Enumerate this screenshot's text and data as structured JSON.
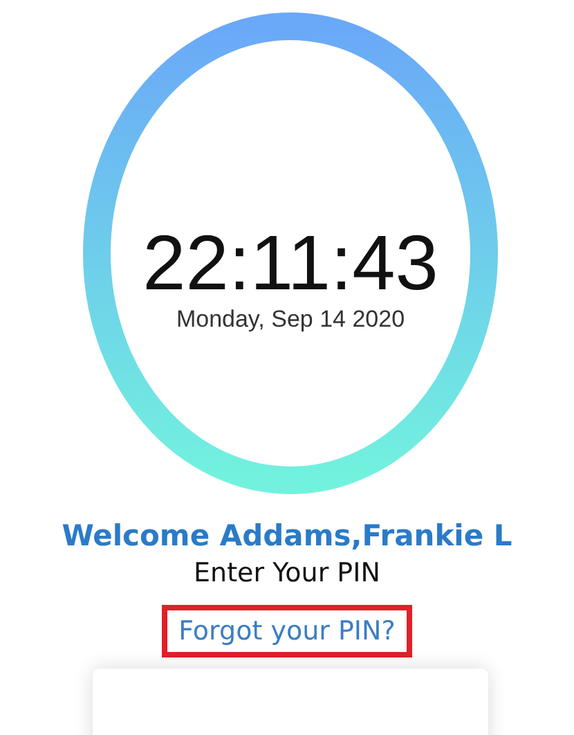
{
  "clock": {
    "time": "22:11:43",
    "date": "Monday, Sep 14 2020"
  },
  "welcome": "Welcome Addams,Frankie L",
  "prompt": "Enter Your PIN",
  "forgot_link": {
    "label": "Forgot your PIN?",
    "highlighted": true
  }
}
